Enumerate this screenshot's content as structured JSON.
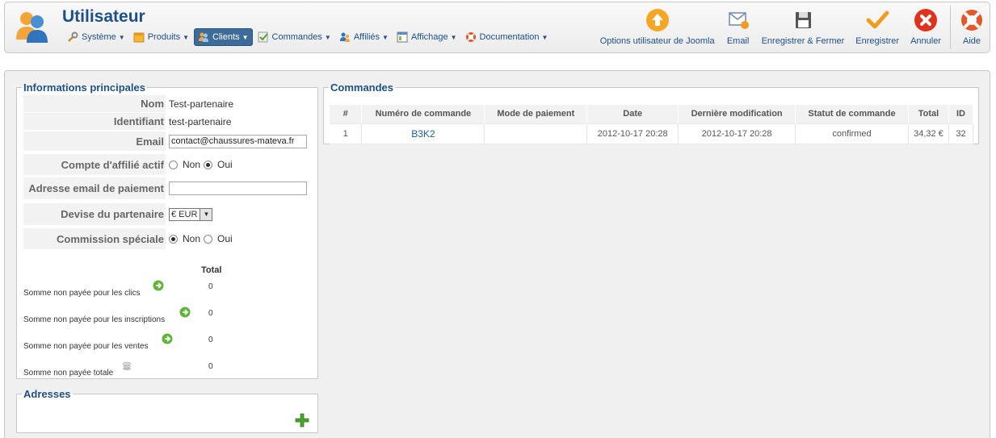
{
  "header": {
    "title": "Utilisateur",
    "menu": [
      {
        "label": "Système",
        "icon": "wrench-icon",
        "active": false
      },
      {
        "label": "Produits",
        "icon": "box-icon",
        "active": false
      },
      {
        "label": "Clients",
        "icon": "clients-icon",
        "active": true
      },
      {
        "label": "Commandes",
        "icon": "orders-icon",
        "active": false
      },
      {
        "label": "Affiliés",
        "icon": "affiliates-icon",
        "active": false
      },
      {
        "label": "Affichage",
        "icon": "display-icon",
        "active": false
      },
      {
        "label": "Documentation",
        "icon": "lifebuoy-icon",
        "active": false
      }
    ],
    "toolbar": {
      "options": "Options utilisateur de Joomla",
      "email": "Email",
      "save_close": "Enregistrer & Fermer",
      "save": "Enregistrer",
      "cancel": "Annuler",
      "help": "Aide"
    }
  },
  "info": {
    "legend": "Informations principales",
    "name_label": "Nom",
    "name_value": "Test-partenaire",
    "id_label": "Identifiant",
    "id_value": "test-partenaire",
    "email_label": "Email",
    "email_value": "contact@chaussures-mateva.fr",
    "affiliate_label": "Compte d'affilié actif",
    "affiliate_no": "Non",
    "affiliate_yes": "Oui",
    "affiliate_selected": "Oui",
    "payment_email_label": "Adresse email de paiement",
    "payment_email_value": "",
    "currency_label": "Devise du partenaire",
    "currency_value": "€ EUR",
    "commission_label": "Commission spéciale",
    "commission_no": "Non",
    "commission_yes": "Oui",
    "commission_selected": "Non",
    "totals_header": "Total",
    "totals": [
      {
        "label": "Somme non payée pour les clics",
        "value": "0"
      },
      {
        "label": "Somme non payée pour les inscriptions",
        "value": "0"
      },
      {
        "label": "Somme non payée pour les ventes",
        "value": "0"
      },
      {
        "label": "Somme non payée totale",
        "value": "0"
      }
    ]
  },
  "orders": {
    "legend": "Commandes",
    "columns": [
      "#",
      "Numéro de commande",
      "Mode de paiement",
      "Date",
      "Dernière modification",
      "Statut de commande",
      "Total",
      "ID"
    ],
    "rows": [
      [
        "1",
        "B3K2",
        "",
        "2012-10-17 20:28",
        "2012-10-17 20:28",
        "confirmed",
        "34,32 €",
        "32"
      ]
    ]
  },
  "addresses": {
    "legend": "Adresses"
  },
  "colors": {
    "accent": "#1d4f8a",
    "active_menu": "#3d6c99"
  }
}
